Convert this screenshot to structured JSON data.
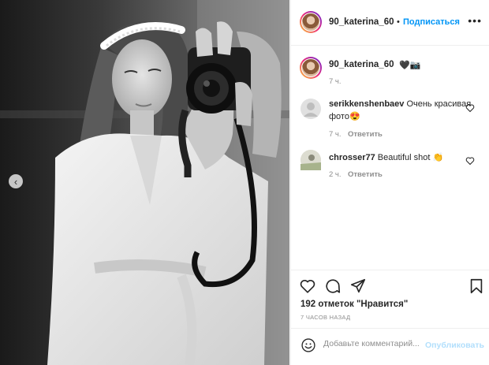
{
  "post": {
    "author": "90_katerina_60",
    "separator": "•",
    "follow_label": "Подписаться",
    "more_label": "•••",
    "caption": {
      "username": "90_katerina_60",
      "text": "🖤📷",
      "time": "7 ч."
    },
    "comments": [
      {
        "username": "serikkenshenbaev",
        "text": "Очень красивая фото",
        "emoji": "😍",
        "time": "7 ч.",
        "reply_label": "Ответить"
      },
      {
        "username": "chrosser77",
        "text": "Beautiful shot",
        "emoji": "👏",
        "time": "2 ч.",
        "reply_label": "Ответить"
      }
    ],
    "likes_text": "192 отметок \"Нравится\"",
    "posted_ago": "7 ЧАСОВ НАЗАД",
    "comment_box": {
      "placeholder": "Добавьте комментарий...",
      "publish_label": "Опубликовать"
    },
    "prev_label": "‹"
  },
  "colors": {
    "accent": "#0095f6",
    "publish_disabled": "#b2dffc",
    "text": "#262626",
    "muted": "#8e8e8e"
  },
  "icons": [
    "heart-icon",
    "comment-icon",
    "share-icon",
    "bookmark-icon",
    "emoji-icon",
    "chevron-left-icon"
  ]
}
